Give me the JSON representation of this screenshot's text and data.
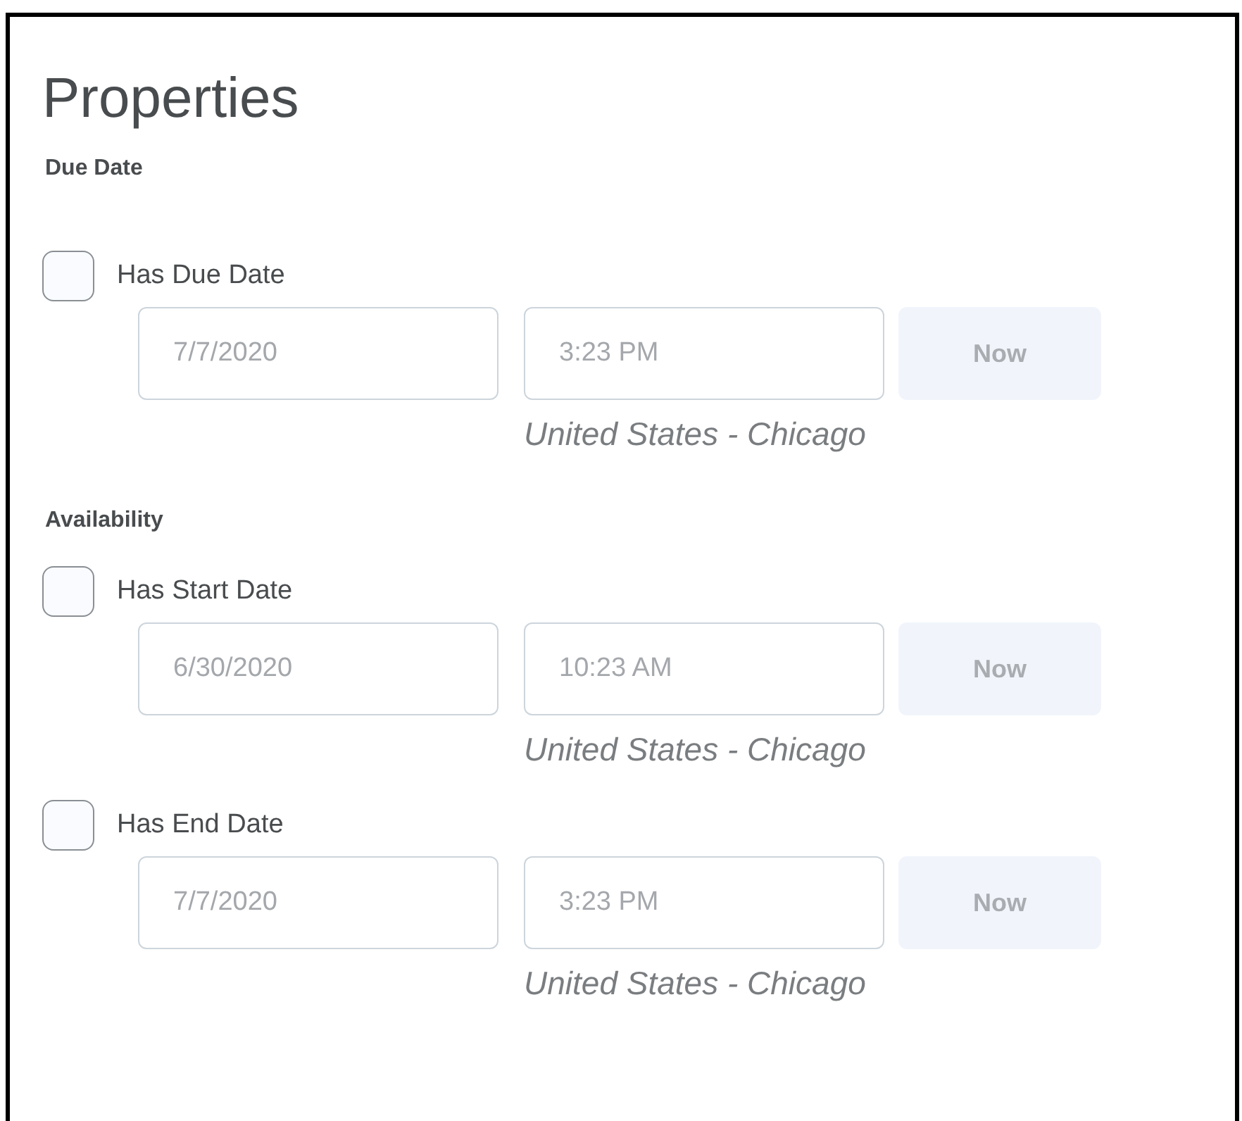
{
  "title": "Properties",
  "sections": [
    {
      "heading": "Due Date",
      "items": [
        {
          "label": "Has Due Date",
          "checked": false,
          "disabled": true,
          "date": "7/7/2020",
          "time": "3:23 PM",
          "now": "Now",
          "timezone": "United States - Chicago"
        }
      ]
    },
    {
      "heading": "Availability",
      "items": [
        {
          "label": "Has Start Date",
          "checked": false,
          "disabled": true,
          "date": "6/30/2020",
          "time": "10:23 AM",
          "now": "Now",
          "timezone": "United States - Chicago"
        },
        {
          "label": "Has End Date",
          "checked": false,
          "disabled": true,
          "date": "7/7/2020",
          "time": "3:23 PM",
          "now": "Now",
          "timezone": "United States - Chicago"
        }
      ]
    }
  ]
}
